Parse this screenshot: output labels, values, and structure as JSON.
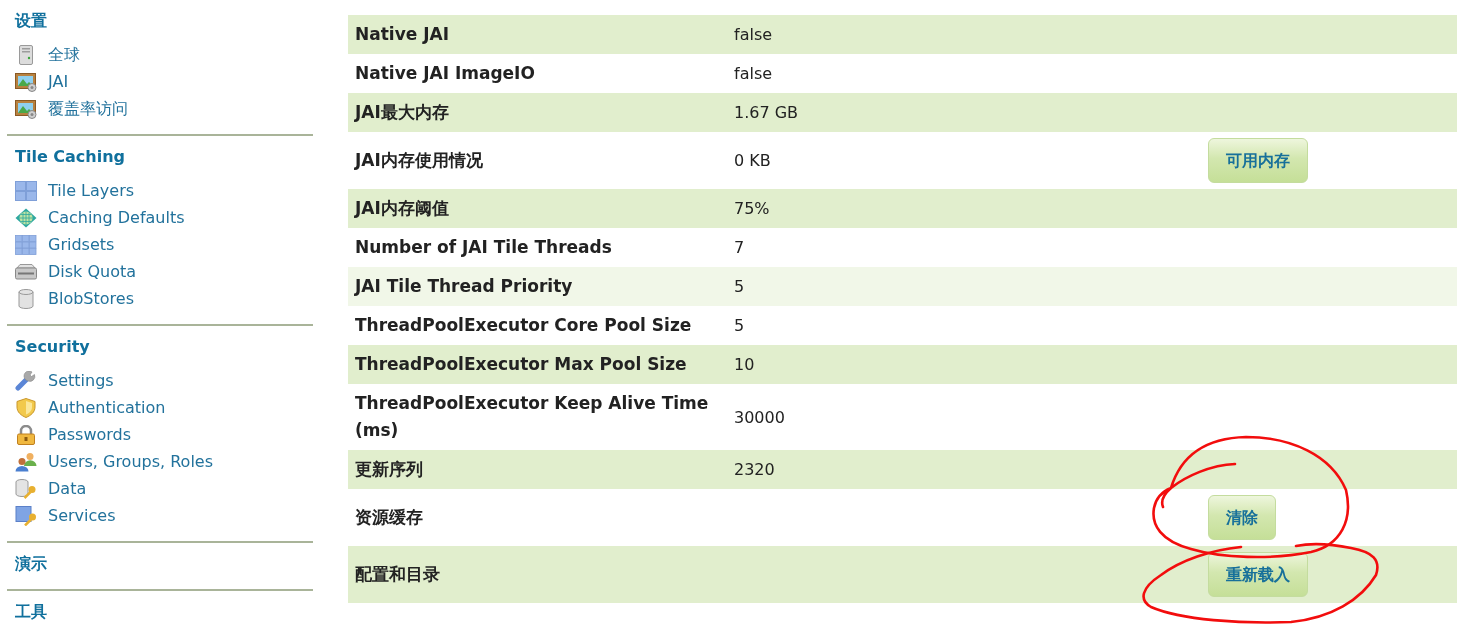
{
  "sidebar": {
    "sections": [
      {
        "title": "设置",
        "items": [
          {
            "label": "全球",
            "kind": "server"
          },
          {
            "label": "JAI",
            "kind": "picture"
          },
          {
            "label": "覆盖率访问",
            "kind": "picture"
          }
        ]
      },
      {
        "title": "Tile Caching",
        "items": [
          {
            "label": "Tile Layers",
            "kind": "tiles"
          },
          {
            "label": "Caching Defaults",
            "kind": "globe"
          },
          {
            "label": "Gridsets",
            "kind": "grid"
          },
          {
            "label": "Disk Quota",
            "kind": "drive"
          },
          {
            "label": "BlobStores",
            "kind": "cylinder"
          }
        ]
      },
      {
        "title": "Security",
        "items": [
          {
            "label": "Settings",
            "kind": "wrench"
          },
          {
            "label": "Authentication",
            "kind": "shield"
          },
          {
            "label": "Passwords",
            "kind": "padlock"
          },
          {
            "label": "Users, Groups, Roles",
            "kind": "users"
          },
          {
            "label": "Data",
            "kind": "database"
          },
          {
            "label": "Services",
            "kind": "service"
          }
        ]
      },
      {
        "title": "演示"
      },
      {
        "title": "工具"
      }
    ]
  },
  "table": {
    "rows": [
      {
        "label": "Native JAI",
        "value": "false",
        "hovered": false,
        "circled": false
      },
      {
        "label": "Native JAI ImageIO",
        "value": "false",
        "hovered": false,
        "circled": false
      },
      {
        "label": "JAI最大内存",
        "value": "1.67 GB",
        "hovered": false,
        "circled": false
      },
      {
        "label": "JAI内存使用情况",
        "value": "0 KB",
        "button": "可用内存",
        "hovered": false,
        "circled": false
      },
      {
        "label": "JAI内存阈值",
        "value": "75%",
        "hovered": false,
        "circled": false
      },
      {
        "label": "Number of JAI Tile Threads",
        "value": "7",
        "hovered": false,
        "circled": false
      },
      {
        "label": "JAI Tile Thread Priority",
        "value": "5",
        "hovered": true,
        "circled": false
      },
      {
        "label": "ThreadPoolExecutor Core Pool Size",
        "value": "5",
        "hovered": false,
        "circled": false
      },
      {
        "label": "ThreadPoolExecutor Max Pool Size",
        "value": "10",
        "hovered": false,
        "circled": false
      },
      {
        "label": "ThreadPoolExecutor Keep Alive Time (ms)",
        "value": "30000",
        "hovered": false,
        "circled": false
      },
      {
        "label": "更新序列",
        "value": "2320",
        "hovered": false,
        "circled": false
      },
      {
        "label": "资源缓存",
        "button": "清除",
        "hovered": false,
        "circled": true
      },
      {
        "label": "配置和目录",
        "button": "重新载入",
        "hovered": false,
        "circled": true
      }
    ]
  }
}
